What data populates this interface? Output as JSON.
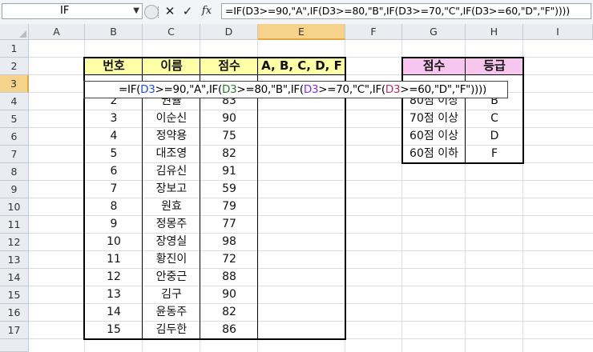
{
  "formula_bar": {
    "name_box": "IF",
    "formula": "=IF(D3>=90,\"A\",IF(D3>=80,\"B\",IF(D3>=70,\"C\",IF(D3>=60,\"D\",\"F\"))))"
  },
  "columns": [
    "A",
    "B",
    "C",
    "D",
    "E",
    "F",
    "G",
    "H",
    "I"
  ],
  "rows": [
    "1",
    "2",
    "3",
    "4",
    "5",
    "6",
    "7",
    "8",
    "9",
    "10",
    "11",
    "12",
    "13",
    "14",
    "15",
    "16",
    "17"
  ],
  "table": {
    "headers": [
      "번호",
      "이름",
      "점수",
      "A, B, C, D, F"
    ],
    "rows": [
      {
        "num": "2",
        "name": "권율",
        "score": "83"
      },
      {
        "num": "3",
        "name": "이순신",
        "score": "90"
      },
      {
        "num": "4",
        "name": "정약용",
        "score": "75"
      },
      {
        "num": "5",
        "name": "대조영",
        "score": "82"
      },
      {
        "num": "6",
        "name": "김유신",
        "score": "91"
      },
      {
        "num": "7",
        "name": "장보고",
        "score": "59"
      },
      {
        "num": "8",
        "name": "원효",
        "score": "79"
      },
      {
        "num": "9",
        "name": "정몽주",
        "score": "77"
      },
      {
        "num": "10",
        "name": "장영실",
        "score": "98"
      },
      {
        "num": "11",
        "name": "황진이",
        "score": "72"
      },
      {
        "num": "12",
        "name": "안중근",
        "score": "88"
      },
      {
        "num": "13",
        "name": "김구",
        "score": "90"
      },
      {
        "num": "14",
        "name": "윤동주",
        "score": "82"
      },
      {
        "num": "15",
        "name": "김두한",
        "score": "86"
      }
    ]
  },
  "edit_cell": {
    "p1": "=IF(",
    "r1": "D3",
    "p2": ">=90,\"A\",IF(",
    "r2": "D3",
    "p3": ">=80,\"B\",IF(",
    "r3": "D3",
    "p4": ">=70,\"C\",IF(",
    "r4": "D3",
    "p5": ">=60,\"D\",\"F\"))))"
  },
  "grade_table": {
    "headers": [
      "점수",
      "등급"
    ],
    "rows": [
      {
        "range": "80점 이상",
        "grade": "B"
      },
      {
        "range": "70점 이상",
        "grade": "C"
      },
      {
        "range": "60점 이상",
        "grade": "D"
      },
      {
        "range": "60점 이하",
        "grade": "F"
      }
    ]
  },
  "colors": {
    "header_yellow": "#ffffa8",
    "header_pink": "#f7c6ee",
    "selected_header": "#f6d38a"
  }
}
